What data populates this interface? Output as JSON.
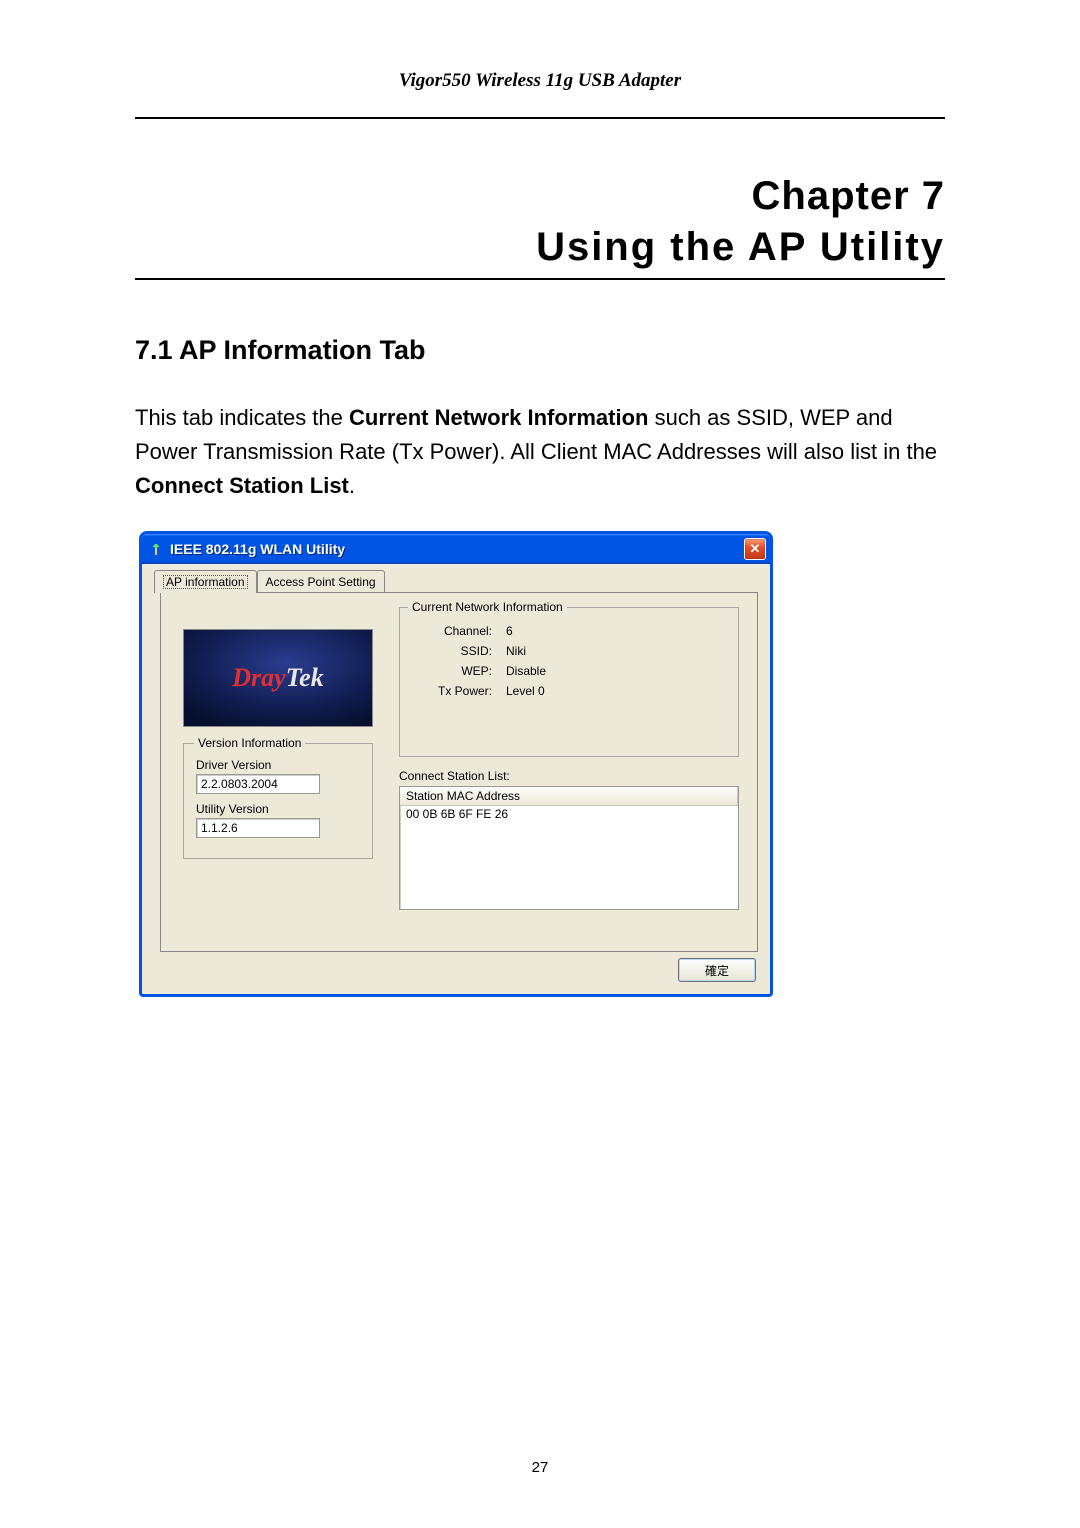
{
  "doc": {
    "running_header": "Vigor550 Wireless 11g USB Adapter",
    "chapter_label": "Chapter  7",
    "chapter_title": "Using  the  AP  Utility",
    "section_heading": "7.1 AP Information Tab",
    "para_prefix": "This tab indicates the ",
    "para_bold1": "Current Network Information",
    "para_mid": " such as SSID, WEP and Power Transmission Rate (Tx Power). All Client MAC Addresses will also list in the ",
    "para_bold2": "Connect Station List",
    "para_suffix": ".",
    "page_number": "27"
  },
  "dialog": {
    "title": "IEEE 802.11g WLAN Utility",
    "tabs": {
      "ap_info": "AP information",
      "ap_setting": "Access Point Setting"
    },
    "logo_dray": "Dray",
    "logo_tek": "Tek",
    "version": {
      "legend": "Version Information",
      "driver_label": "Driver Version",
      "driver_value": "2.2.0803.2004",
      "utility_label": "Utility Version",
      "utility_value": "1.1.2.6"
    },
    "net": {
      "legend": "Current Network Information",
      "channel_k": "Channel:",
      "channel_v": "6",
      "ssid_k": "SSID:",
      "ssid_v": "Niki",
      "wep_k": "WEP:",
      "wep_v": "Disable",
      "tx_k": "Tx Power:",
      "tx_v": "Level 0"
    },
    "connect": {
      "label": "Connect Station List:",
      "header": "Station MAC Address",
      "rows": [
        "00 0B 6B 6F FE 26"
      ]
    },
    "ok": "確定"
  }
}
